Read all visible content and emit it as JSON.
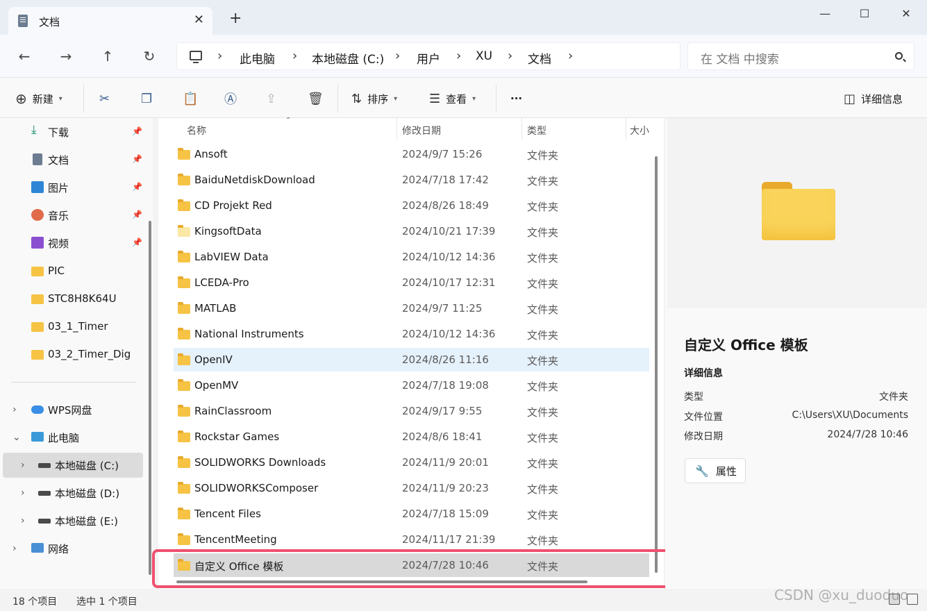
{
  "window": {
    "tab_title": "文档",
    "tab_close": "✕",
    "new_tab": "+",
    "minimize": "—",
    "maximize": "☐",
    "close": "✕"
  },
  "nav": {
    "back": "←",
    "forward": "→",
    "up": "↑",
    "refresh": "↻",
    "breadcrumb": [
      "此电脑",
      "本地磁盘 (C:)",
      "用户",
      "XU",
      "文档"
    ],
    "chevron": "›",
    "search_placeholder": "在 文档 中搜索"
  },
  "toolbar": {
    "new_label": "新建",
    "sort_label": "排序",
    "view_label": "查看",
    "more_label": "···",
    "details_label": "详细信息"
  },
  "sidebar": {
    "quick_access": [
      {
        "label": "下载",
        "icon": "download-icon",
        "pinned": true
      },
      {
        "label": "文档",
        "icon": "document-icon",
        "pinned": true
      },
      {
        "label": "图片",
        "icon": "pictures-icon",
        "pinned": true
      },
      {
        "label": "音乐",
        "icon": "music-icon",
        "pinned": true
      },
      {
        "label": "视频",
        "icon": "video-icon",
        "pinned": true
      },
      {
        "label": "PIC",
        "icon": "folder-icon",
        "pinned": false
      },
      {
        "label": "STC8H8K64U",
        "icon": "folder-icon",
        "pinned": false
      },
      {
        "label": "03_1_Timer",
        "icon": "folder-icon",
        "pinned": false
      },
      {
        "label": "03_2_Timer_Dig",
        "icon": "folder-icon",
        "pinned": false
      }
    ],
    "tree": [
      {
        "label": "WPS网盘",
        "icon": "cloud-icon"
      },
      {
        "label": "此电脑",
        "icon": "computer-icon"
      },
      {
        "label": "本地磁盘 (C:)",
        "icon": "drive-icon"
      },
      {
        "label": "本地磁盘 (D:)",
        "icon": "drive-icon"
      },
      {
        "label": "本地磁盘 (E:)",
        "icon": "drive-icon"
      },
      {
        "label": "网络",
        "icon": "network-icon"
      }
    ]
  },
  "filelist": {
    "columns": [
      "名称",
      "修改日期",
      "类型",
      "大小"
    ],
    "rows": [
      {
        "name": "Ansoft",
        "date": "2024/9/7 15:26",
        "type": "文件夹"
      },
      {
        "name": "BaiduNetdiskDownload",
        "date": "2024/7/18 17:42",
        "type": "文件夹"
      },
      {
        "name": "CD Projekt Red",
        "date": "2024/8/26 18:49",
        "type": "文件夹"
      },
      {
        "name": "KingsoftData",
        "date": "2024/10/21 17:39",
        "type": "文件夹"
      },
      {
        "name": "LabVIEW Data",
        "date": "2024/10/12 14:36",
        "type": "文件夹"
      },
      {
        "name": "LCEDA-Pro",
        "date": "2024/10/17 12:31",
        "type": "文件夹"
      },
      {
        "name": "MATLAB",
        "date": "2024/9/7 11:25",
        "type": "文件夹"
      },
      {
        "name": "National Instruments",
        "date": "2024/10/12 14:36",
        "type": "文件夹"
      },
      {
        "name": "OpenIV",
        "date": "2024/8/26 11:16",
        "type": "文件夹"
      },
      {
        "name": "OpenMV",
        "date": "2024/7/18 19:08",
        "type": "文件夹"
      },
      {
        "name": "RainClassroom",
        "date": "2024/9/17 9:55",
        "type": "文件夹"
      },
      {
        "name": "Rockstar Games",
        "date": "2024/8/6 18:41",
        "type": "文件夹"
      },
      {
        "name": "SOLIDWORKS Downloads",
        "date": "2024/11/9 20:01",
        "type": "文件夹"
      },
      {
        "name": "SOLIDWORKSComposer",
        "date": "2024/11/9 20:23",
        "type": "文件夹"
      },
      {
        "name": "Tencent Files",
        "date": "2024/7/18 15:09",
        "type": "文件夹"
      },
      {
        "name": "TencentMeeting",
        "date": "2024/11/17 21:39",
        "type": "文件夹"
      },
      {
        "name": "自定义 Office 模板",
        "date": "2024/7/28 10:46",
        "type": "文件夹"
      }
    ]
  },
  "details": {
    "title": "自定义 Office 模板",
    "section": "详细信息",
    "type_key": "类型",
    "type_val": "文件夹",
    "location_key": "文件位置",
    "location_val": "C:\\Users\\XU\\Documents",
    "modified_key": "修改日期",
    "modified_val": "2024/7/28 10:46",
    "properties_label": "属性"
  },
  "status": {
    "count": "18 个项目",
    "selected": "选中 1 个项目"
  },
  "watermark": "CSDN @xu_duoduo",
  "colors": {
    "folder": "#f6c344",
    "highlight_border": "#f0506e",
    "hover_row": "#e5f1fb",
    "selected_row": "#d9d9d9"
  }
}
